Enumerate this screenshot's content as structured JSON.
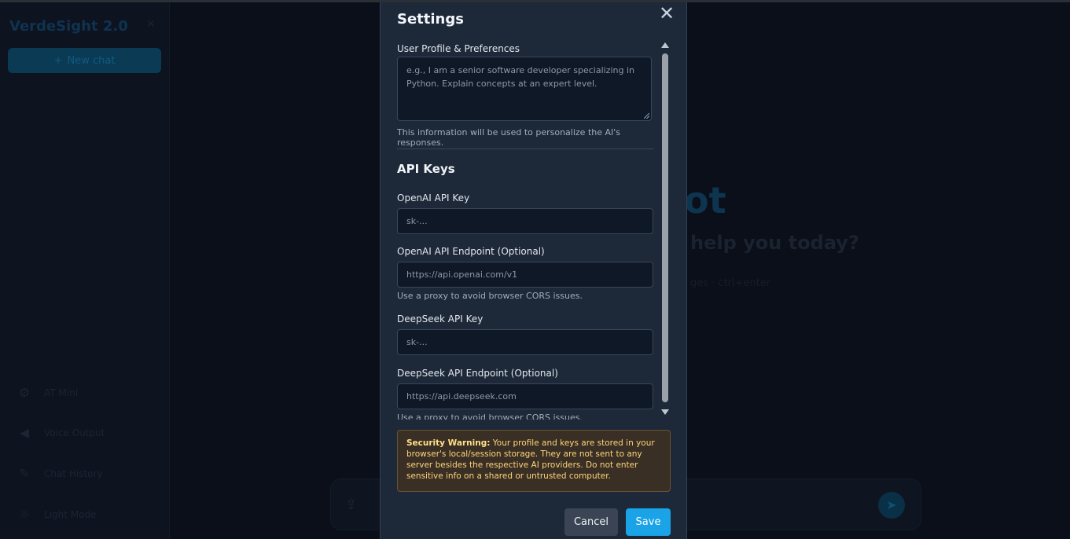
{
  "app": {
    "title": "VerdeSight 2.0",
    "new_chat_label": "New chat",
    "sidebar_items": [
      {
        "label": "AT Mini",
        "icon": "gear-icon"
      },
      {
        "label": "Voice Output",
        "icon": "speaker-icon"
      },
      {
        "label": "Chat History",
        "icon": "broom-icon"
      },
      {
        "label": "Light Mode",
        "icon": "sun-icon"
      }
    ],
    "hero_title": "ot",
    "hero_subtitle": "help you today?",
    "hero_hint": "ges · ctrl+enter"
  },
  "modal": {
    "title": "Settings",
    "profile": {
      "label": "User Profile & Preferences",
      "placeholder": "e.g., I am a senior software developer specializing in Python. Explain concepts at an expert level.",
      "help": "This information will be used to personalize the AI's responses."
    },
    "api_section_title": "API Keys",
    "fields": {
      "openai_key": {
        "label": "OpenAI API Key",
        "placeholder": "sk-..."
      },
      "openai_endpoint": {
        "label": "OpenAI API Endpoint (Optional)",
        "placeholder": "https://api.openai.com/v1",
        "help": "Use a proxy to avoid browser CORS issues."
      },
      "deepseek_key": {
        "label": "DeepSeek API Key",
        "placeholder": "sk-..."
      },
      "deepseek_endpoint": {
        "label": "DeepSeek API Endpoint (Optional)",
        "placeholder": "https://api.deepseek.com",
        "help": "Use a proxy to avoid browser CORS issues."
      }
    },
    "warning": {
      "title": "Security Warning:",
      "text": " Your profile and keys are stored in your browser's local/session storage. They are not sent to any server besides the respective AI providers. Do not enter sensitive info on a shared or untrusted computer."
    },
    "cancel_label": "Cancel",
    "save_label": "Save"
  },
  "colors": {
    "accent": "#1aa3e6",
    "modal_bg": "#1d2838",
    "warning_text": "#ffd479",
    "warning_bg": "#3a2f25"
  }
}
